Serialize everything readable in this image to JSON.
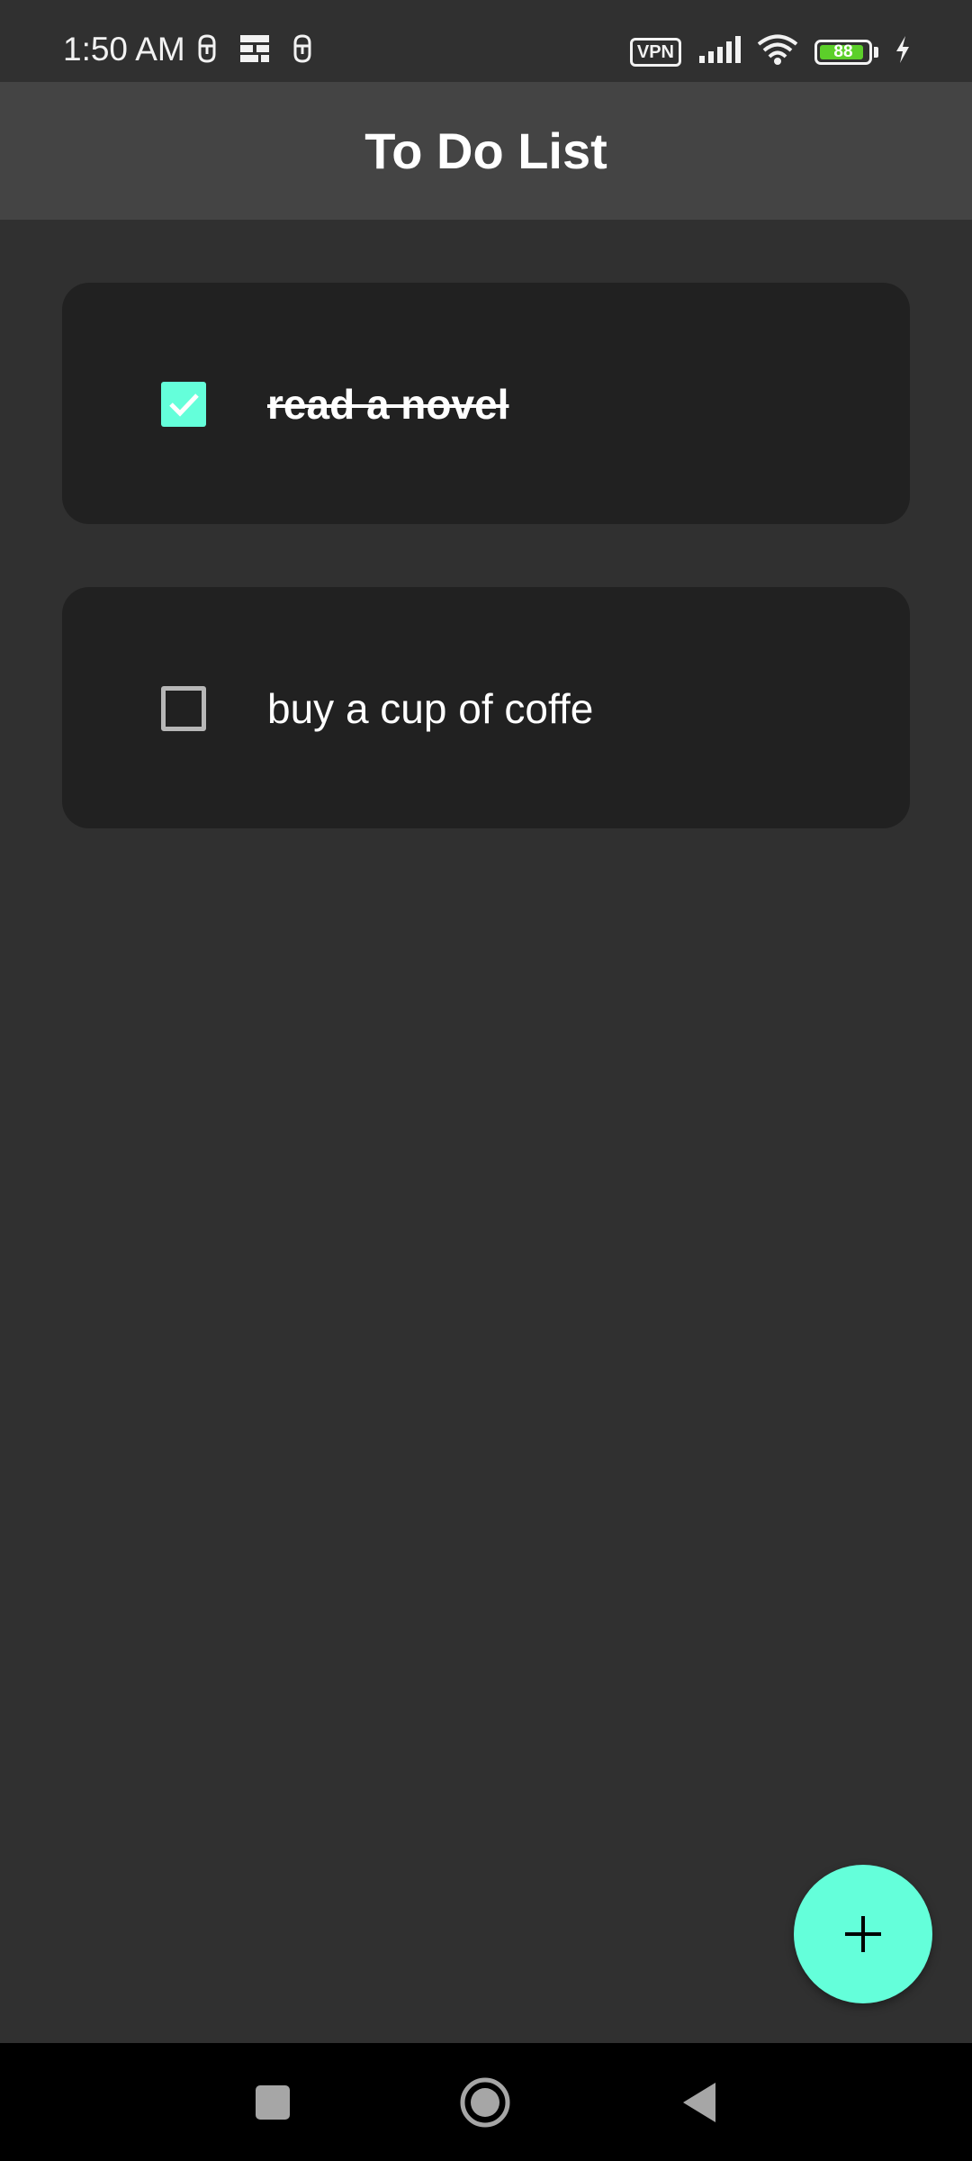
{
  "status_bar": {
    "time": "1:50 AM",
    "vpn_label": "VPN",
    "battery_level": "88",
    "left_icons": [
      "notification-icon",
      "grid-app-icon",
      "notification-icon"
    ],
    "right_icons": [
      "vpn-icon",
      "cellular-signal-icon",
      "wifi-icon",
      "battery-icon",
      "charging-bolt-icon"
    ]
  },
  "app_bar": {
    "title": "To Do List"
  },
  "todos": [
    {
      "text": "read a novel",
      "done": true
    },
    {
      "text": "buy a cup of coffe",
      "done": false
    }
  ],
  "fab": {
    "icon": "plus-icon"
  },
  "nav_bar": {
    "icons": [
      "recents-square-icon",
      "home-circle-icon",
      "back-triangle-icon"
    ]
  },
  "colors": {
    "background": "#303030",
    "app_bar": "#444444",
    "card": "#212121",
    "accent": "#64ffda",
    "battery_fill": "#5ccf2a"
  }
}
